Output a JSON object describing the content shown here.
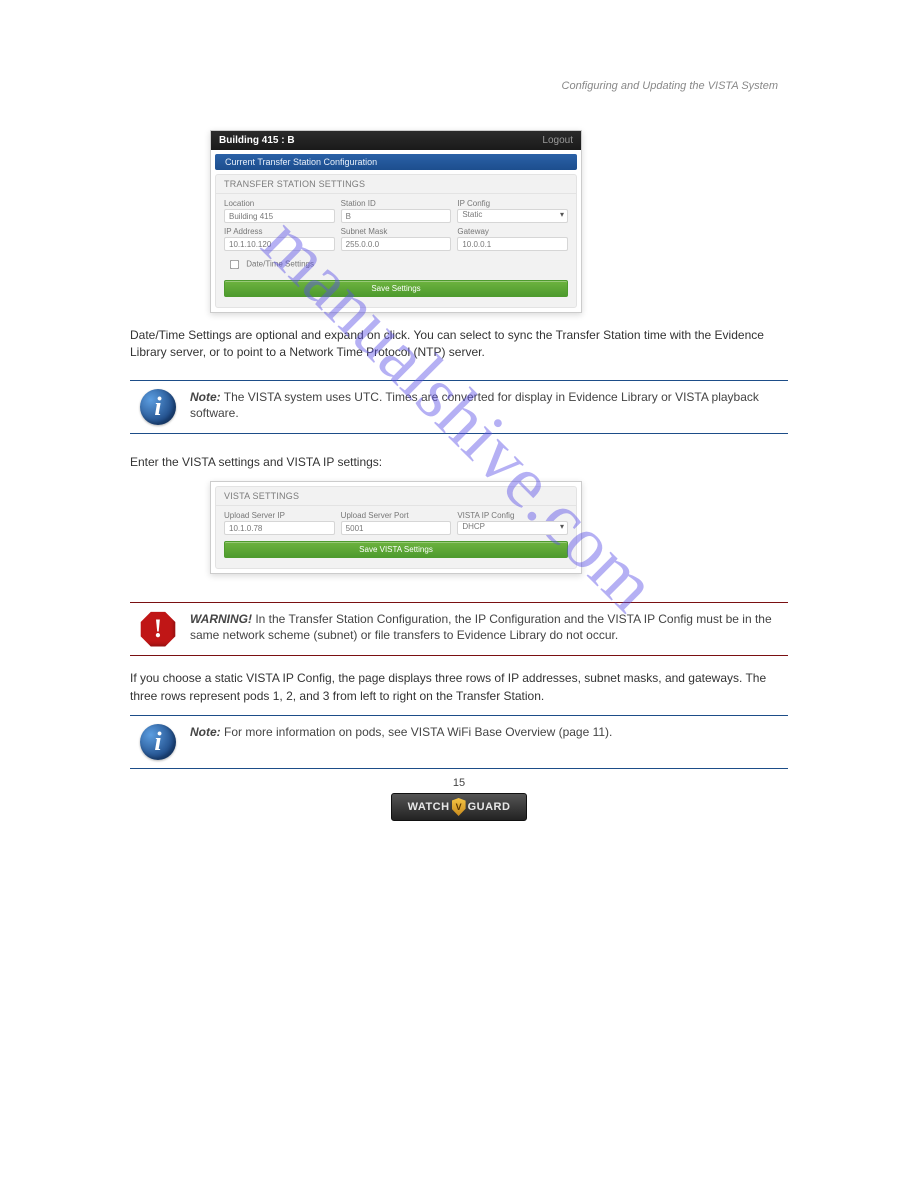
{
  "header_right": "Configuring and Updating the VISTA System",
  "watermark": "manualshive.com",
  "shot1": {
    "title_prefix": "Building 415 : ",
    "title_bold": "B",
    "logout": "Logout",
    "bluebar": "Current Transfer Station Configuration",
    "panel_title": "TRANSFER STATION SETTINGS",
    "rowA": {
      "location_label": "Location",
      "location_value": "Building 415",
      "station_label": "Station ID",
      "station_value": "B",
      "ipcfg_label": "IP Config",
      "ipcfg_value": "Static"
    },
    "rowB": {
      "ip_label": "IP Address",
      "ip_value": "10.1.10.120",
      "mask_label": "Subnet Mask",
      "mask_value": "255.0.0.0",
      "gw_label": "Gateway",
      "gw_value": "10.0.0.1"
    },
    "datetime": "Date/Time Settings",
    "save_btn": "Save Settings"
  },
  "para_after_shot1": "Date/Time Settings are optional and expand on click. You can select to sync the Transfer Station time with the Evidence Library server, or to point to a Network Time Protocol (NTP) server.",
  "note1": {
    "label": "Note:",
    "text": " The VISTA system uses UTC. Times are converted for display in Evidence Library or VISTA playback software."
  },
  "para_vista_settings": "Enter the VISTA settings and VISTA IP settings:",
  "shot2": {
    "panel_title": "VISTA SETTINGS",
    "up_ip_label": "Upload Server IP",
    "up_ip_value": "10.1.0.78",
    "up_port_label": "Upload Server Port",
    "up_port_value": "5001",
    "vcfg_label": "VISTA IP Config",
    "vcfg_value": "DHCP",
    "save_btn": "Save VISTA Settings"
  },
  "warn1": {
    "label": "WARNING!",
    "text": " In the Transfer Station Configuration, the IP Configuration and the VISTA IP Config must be in the same network scheme (subnet) or file transfers to Evidence Library do not occur."
  },
  "para_after_warn": "If you choose a static VISTA IP Config, the page displays three rows of IP addresses, subnet masks, and gateways. The three rows represent pods 1, 2, and 3 from left to right on the Transfer Station.",
  "note2": {
    "label": "Note:",
    "text": " For more information on pods, see VISTA WiFi Base Overview (page 11)."
  },
  "page_number": "15",
  "logo": {
    "left": "WATCH",
    "right": "GUARD"
  }
}
